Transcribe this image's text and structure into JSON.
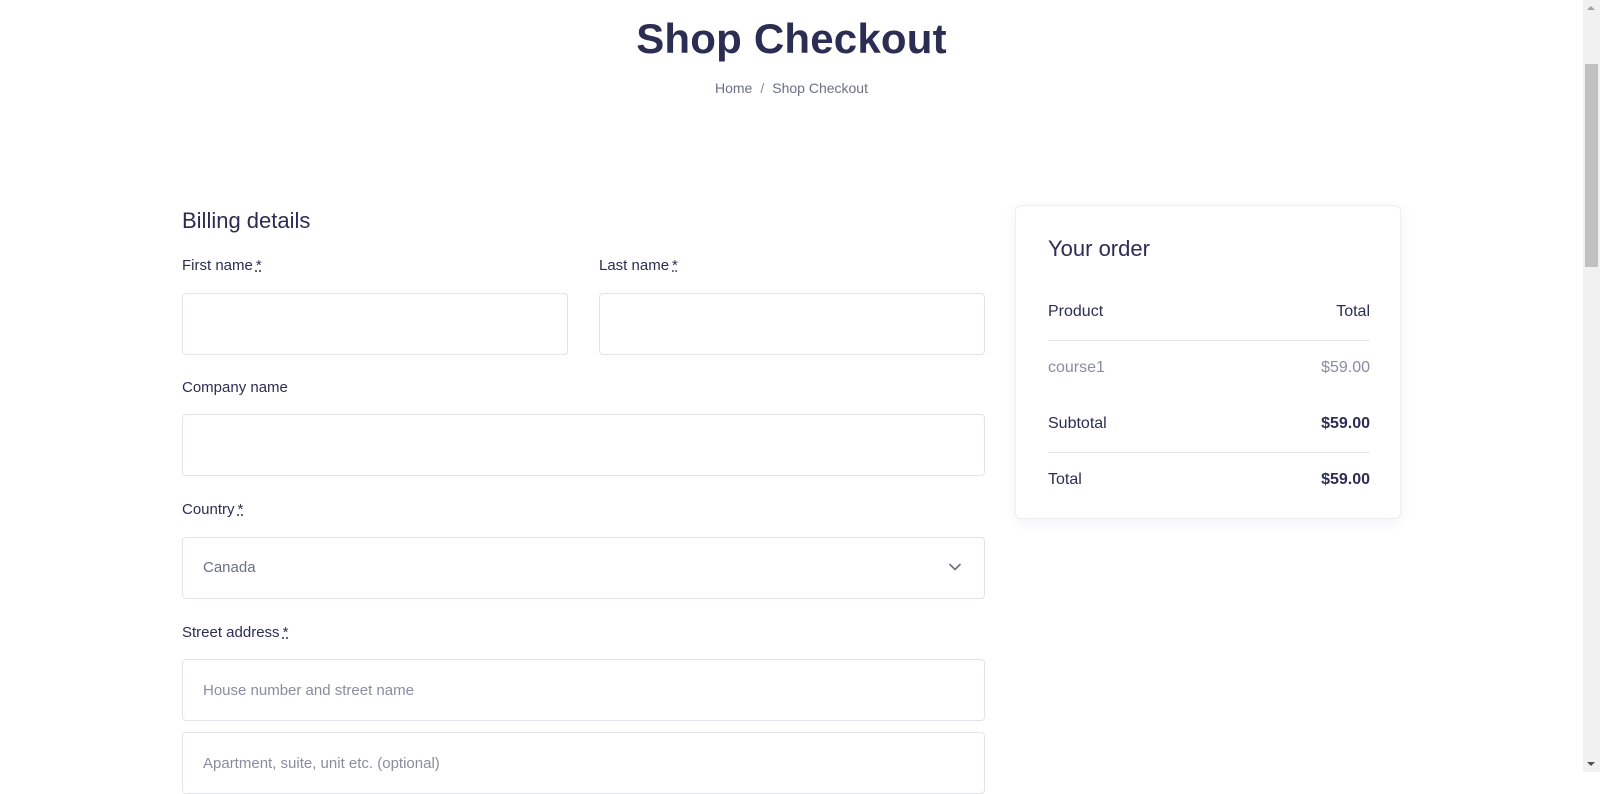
{
  "header": {
    "title": "Shop Checkout",
    "breadcrumb": {
      "home": "Home",
      "separator": "/",
      "current": "Shop Checkout"
    }
  },
  "billing": {
    "title": "Billing details",
    "required_marker": "*",
    "first_name": {
      "label": "First name",
      "value": ""
    },
    "last_name": {
      "label": "Last name",
      "value": ""
    },
    "company_name": {
      "label": "Company name",
      "value": ""
    },
    "country": {
      "label": "Country",
      "selected": "Canada"
    },
    "street_address": {
      "label": "Street address",
      "line1_placeholder": "House number and street name",
      "line2_placeholder": "Apartment, suite, unit etc. (optional)"
    }
  },
  "order": {
    "title": "Your order",
    "columns": {
      "product": "Product",
      "total": "Total"
    },
    "items": [
      {
        "name": "course1",
        "price": "$59.00"
      }
    ],
    "subtotal": {
      "label": "Subtotal",
      "value": "$59.00"
    },
    "total": {
      "label": "Total",
      "value": "$59.00"
    }
  },
  "colors": {
    "heading": "#2b2d52",
    "muted": "#8a8ca0",
    "border": "#e3e4ea"
  }
}
